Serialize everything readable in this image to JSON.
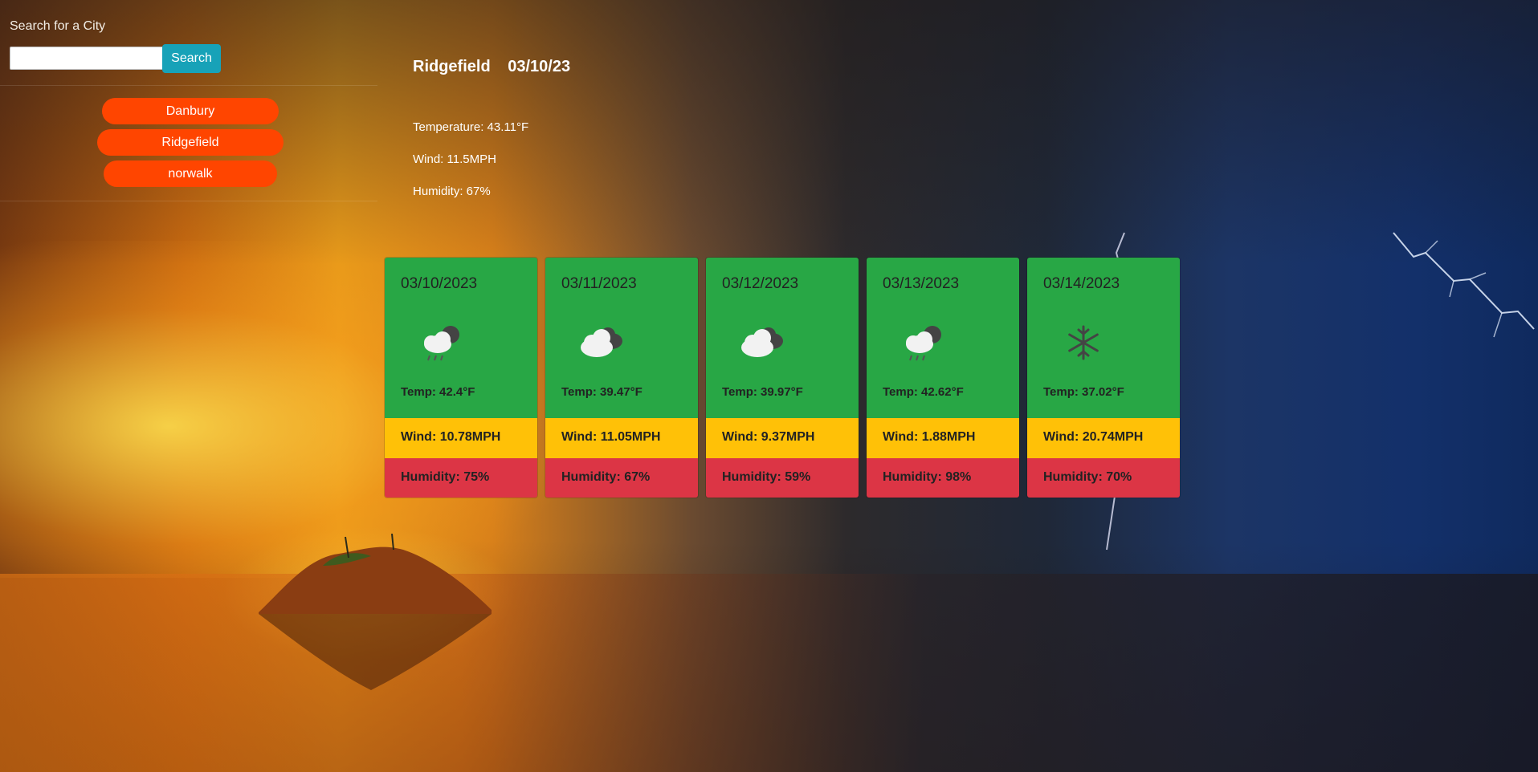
{
  "search": {
    "label": "Search for a City",
    "placeholder": "",
    "value": "",
    "button_label": "Search"
  },
  "history": [
    {
      "label": "Danbury"
    },
    {
      "label": "Ridgefield"
    },
    {
      "label": "norwalk"
    }
  ],
  "current": {
    "city": "Ridgefield",
    "date": "03/10/23",
    "temperature": "Temperature: 43.11°F",
    "wind": "Wind: 11.5MPH",
    "humidity": "Humidity: 67%"
  },
  "forecast": [
    {
      "date": "03/10/2023",
      "icon": "cloud-rain-icon",
      "temp": "Temp: 42.4°F",
      "wind": "Wind: 10.78MPH",
      "humidity": "Humidity: 75%"
    },
    {
      "date": "03/11/2023",
      "icon": "cloudy-icon",
      "temp": "Temp: 39.47°F",
      "wind": "Wind: 11.05MPH",
      "humidity": "Humidity: 67%"
    },
    {
      "date": "03/12/2023",
      "icon": "cloudy-icon",
      "temp": "Temp: 39.97°F",
      "wind": "Wind: 9.37MPH",
      "humidity": "Humidity: 59%"
    },
    {
      "date": "03/13/2023",
      "icon": "cloud-rain-icon",
      "temp": "Temp: 42.62°F",
      "wind": "Wind: 1.88MPH",
      "humidity": "Humidity: 98%"
    },
    {
      "date": "03/14/2023",
      "icon": "snowflake-icon",
      "temp": "Temp: 37.02°F",
      "wind": "Wind: 20.74MPH",
      "humidity": "Humidity: 70%"
    }
  ],
  "colors": {
    "search_button": "#17a2b8",
    "history_button": "#ff4500",
    "card_top": "#28a745",
    "card_wind": "#ffc107",
    "card_humidity": "#dc3545"
  }
}
